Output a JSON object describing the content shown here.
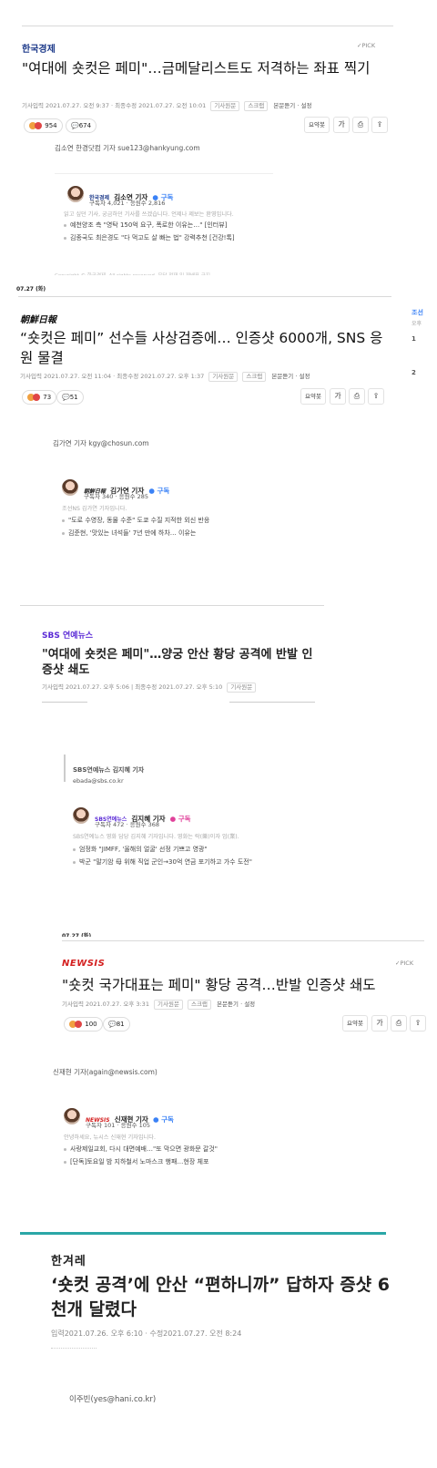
{
  "articles": [
    {
      "press": "한국경제",
      "pick": "✓PICK",
      "title": "\"여대에 숏컷은 페미\"…금메달리스트도 저격하는 좌표 찍기",
      "meta": "기사입력 2021.07.27. 오전 9:37 · 최종수정 2021.07.27. 오전 10:01",
      "tags": [
        "기사원문",
        "스크랩"
      ],
      "listen": "본문듣기 · 설정",
      "reactions": "954",
      "comments": "674",
      "byline": "김소연 한경닷컴 기자 sue123@hankyung.com",
      "card": {
        "press": "한국경제",
        "name": "김소연 기자",
        "subscribe": "구독",
        "stats": "구독자 4,021 · 응원수 2,816",
        "desc": "읽고 싶던 기사, 궁금하던 기사를 쓰겠습니다. 언제나 제보는 환영입니다.",
        "items": [
          "예천양조 측 \"영탁 150억 요구, 폭로한 이유는…\" [인터뷰]",
          "김종국도 최은경도 \"다 먹고도 살 빠는 법\" 강력추천 [건강!톡]"
        ]
      },
      "cut": "Copyright © 한국경제. All rights reserved. 무단 전재 및 재배포 금지",
      "date_strip": "07.27 (화)"
    },
    {
      "press": "朝鮮日報",
      "title": "“숏컷은 페미” 선수들 사상검증에… 인증샷 6000개, SNS 응원 물결",
      "meta": "기사입력 2021.07.27. 오전 11:04 · 최종수정 2021.07.27. 오후 1:37",
      "tags": [
        "기사원문",
        "스크랩"
      ],
      "listen": "본문듣기 · 설정",
      "reactions": "73",
      "comments": "51",
      "byline": "김가연 기자 kgy@chosun.com",
      "card": {
        "press": "朝鮮日報",
        "name": "김가연 기자",
        "subscribe": "구독",
        "stats": "구독자 340 · 응원수 285",
        "desc": "조선NS 김가연 기자입니다.",
        "items": [
          "\"도로 수영장, 동물 수준\" 도쿄 수질 지적한 외신 반응",
          "김준현, '맛있는 녀석들' 7년 만에 하차… 이유는"
        ]
      },
      "side": {
        "head": "조선",
        "sub": "오후",
        "n1": "1",
        "n2": "2"
      }
    },
    {
      "press": "SBS 연예뉴스",
      "title": "\"여대에 숏컷은 페미\"…양궁 안산 황당 공격에 반발 인증샷 쇄도",
      "meta": "기사입력 2021.07.27. 오후 5:06 | 최종수정 2021.07.27. 오후 5:10",
      "tags": [
        "기사원문"
      ],
      "byline_name": "SBS연예뉴스 김지혜 기자",
      "byline_mail": "ebada@sbs.co.kr",
      "card": {
        "press": "SBS연예뉴스",
        "name": "김지혜 기자",
        "subscribe": "구독",
        "stats": "구독자 472 · 응원수 368",
        "desc": "SBS연예뉴스 영화 담당 김지혜 기자입니다. 영화는 락(樂)이자 업(業).",
        "items": [
          "엄정화 \"JIMFF, '올해의 얼굴' 선정 기쁘고 영광\"",
          "박군 \"말기암 母 위해 직업 군인→30억 연금 포기하고 가수 도전\""
        ]
      }
    },
    {
      "date_strip": "07.27 (화)",
      "press": "NEWSIS",
      "pick": "✓PICK",
      "title": "\"숏컷 국가대표는 페미\" 황당 공격…반발 인증샷 쇄도",
      "meta": "기사입력 2021.07.27. 오후 3:31",
      "tags": [
        "기사원문",
        "스크랩"
      ],
      "listen": "본문듣기 · 설정",
      "reactions": "100",
      "comments": "81",
      "byline": "신재현 기자(again@newsis.com)",
      "card": {
        "press": "NEWSIS",
        "name": "신재현 기자",
        "subscribe": "구독",
        "stats": "구독자 101 · 응원수 105",
        "desc": "안녕하세요, 뉴시스 신재현 기자입니다.",
        "items": [
          "사랑제일교회, 다시 대면예배…\"또 막으면 광화문 갈것\"",
          "[단독]토요일 밤 지하철서 노마스크 행패…현장 체포"
        ]
      }
    },
    {
      "press": "한겨레",
      "title": "‘숏컷 공격’에 안산 “편하니까” 답하자 증샷 6천개 달렸다",
      "meta": "입력2021.07.26. 오후 6:10 · 수정2021.07.27. 오전 8:24",
      "byline": "이주빈(yes@hani.co.kr)"
    }
  ],
  "toolbar": {
    "font": "요약봇",
    "size": "가",
    "print": "⎙",
    "share": "⇪"
  },
  "colors": {
    "accent_blue": "#3b82f6",
    "hani_bar": "#2aa7a7",
    "newsis_red": "#d42020",
    "sbs_purple": "#5b2bd6",
    "subscribe_pink": "#e0409a"
  }
}
